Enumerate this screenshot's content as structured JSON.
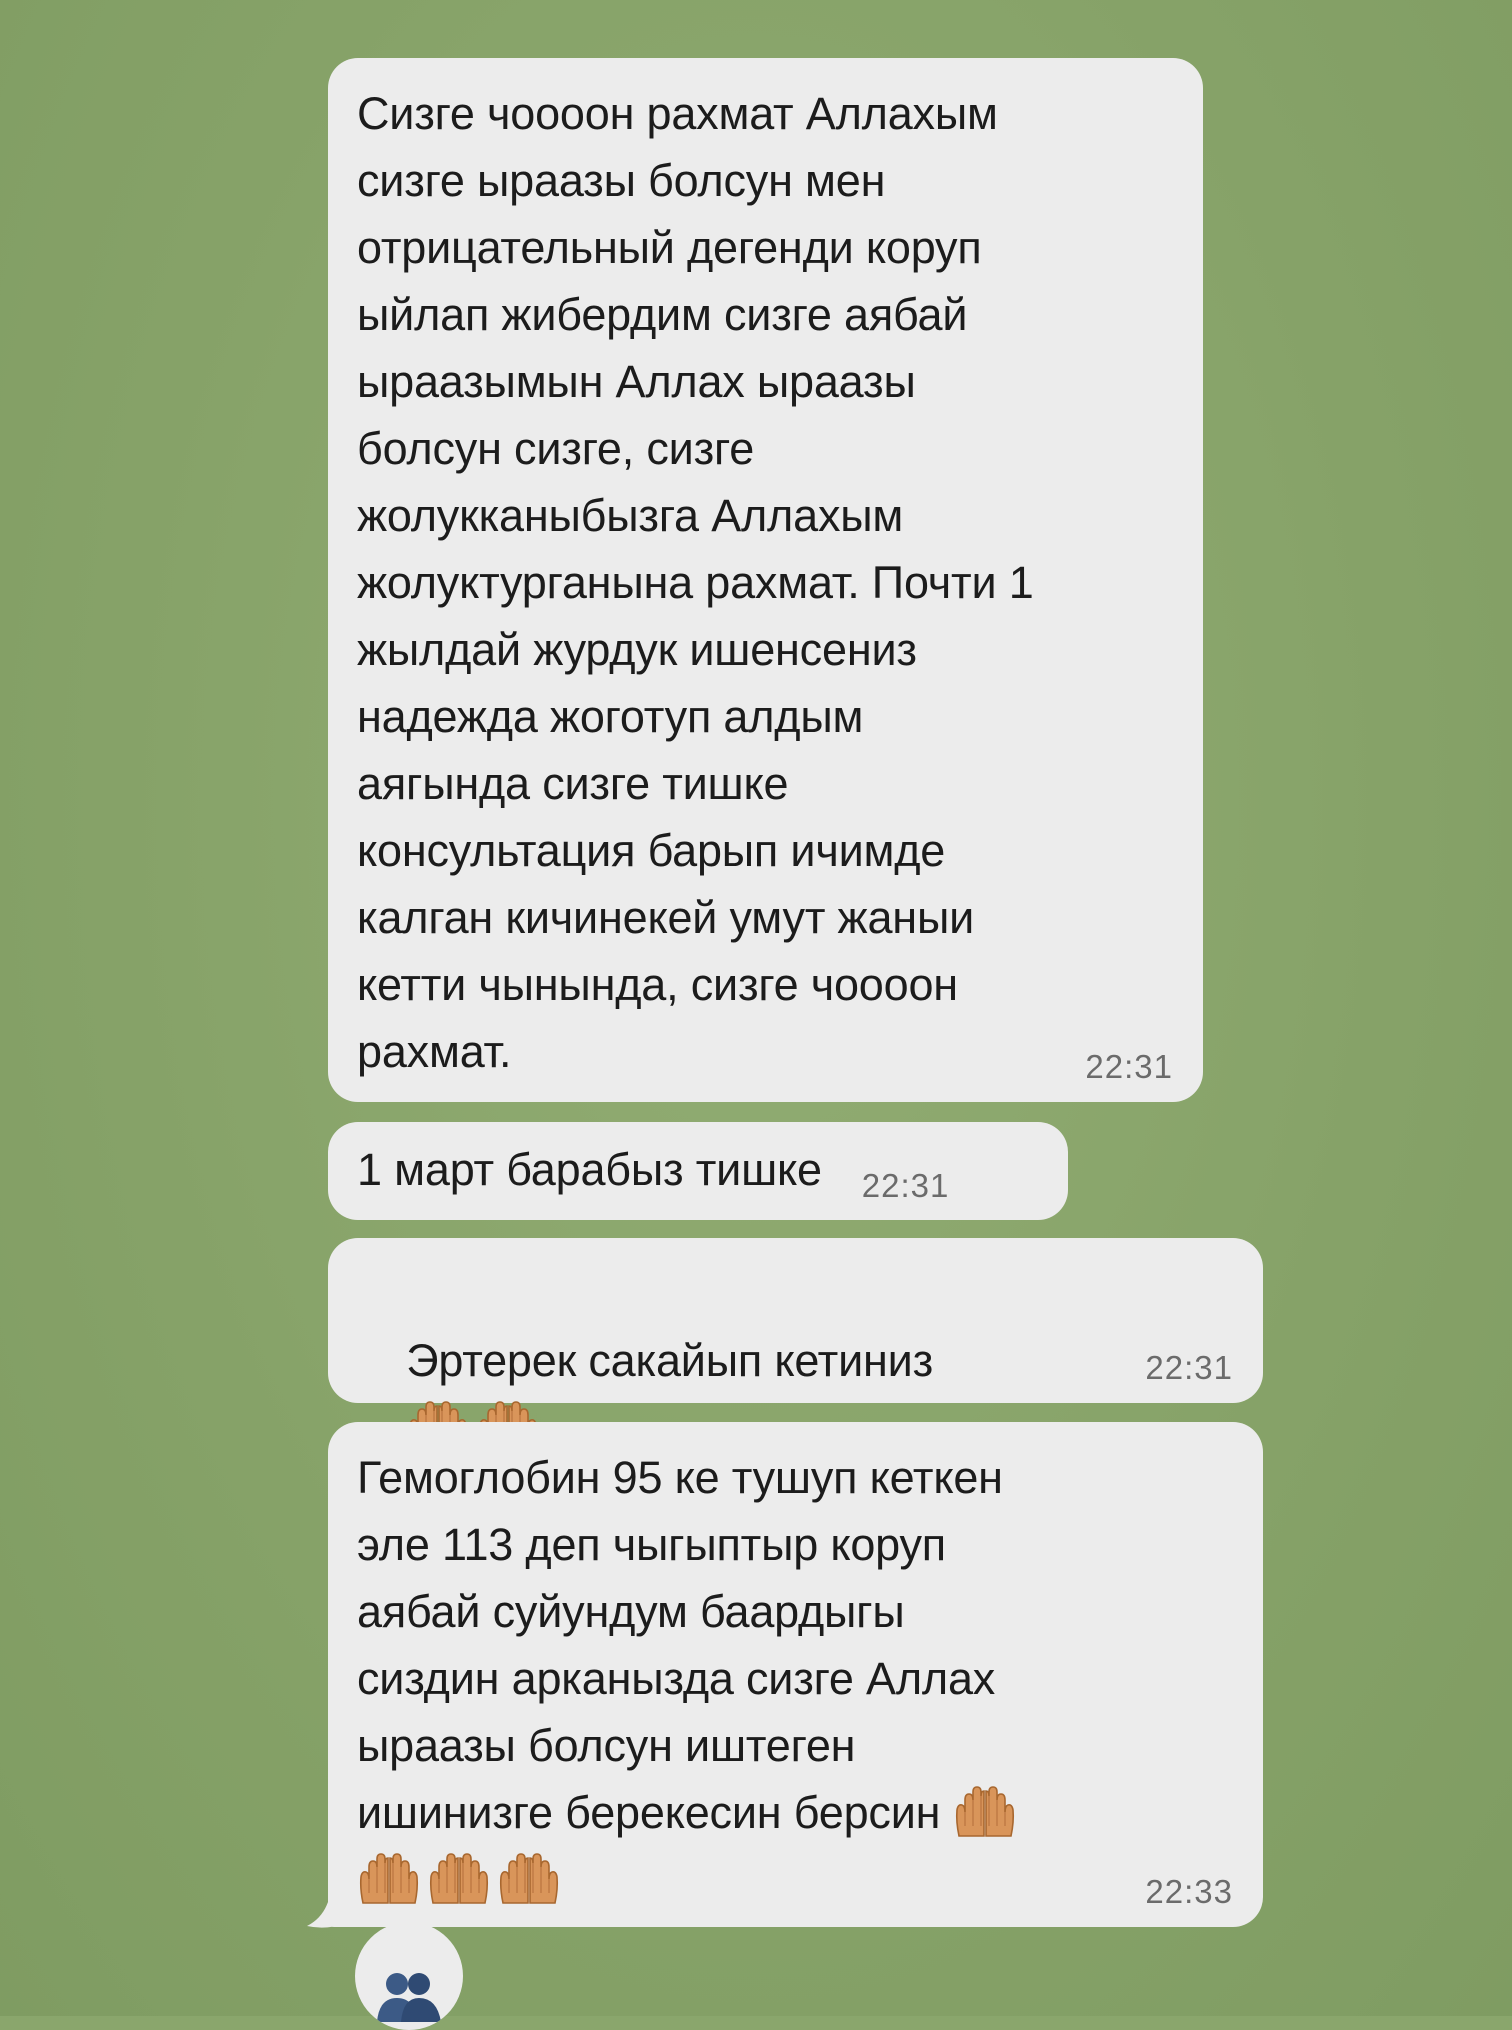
{
  "chat": {
    "messages": [
      {
        "text": "Сизге чоооон рахмат Аллахым\nсизге ыраазы болсун мен\nотрицательный дегенди коруп\nыйлап жибердим сизге аябай\nыраазымын Аллах ыраазы\nболсун сизге, сизге\nжолукканыбызга Аллахым\nжолуктурганына рахмат. Почти 1\nжылдай журдук ишенсениз\nнадежда жоготуп алдым\nаягында сизге тишке\nконсультация барып ичимде\nкалган кичинекей умут жаныи\nкетти чынында, сизге чоооон\nрахмат.",
        "time": "22:31"
      },
      {
        "text": "1 март барабыз тишке",
        "time": "22:31"
      },
      {
        "text": "Эртерек сакайып кетиниз",
        "time": "22:31",
        "emoji": "palms-up-together"
      },
      {
        "text": "Гемоглобин 95 ке тушуп кеткен\nэле 113 деп чыгыптыр коруп\nаябай суйундум баардыгы\nсиздин арканызда сизге Аллах\nыраазы болсун иштеген\nишинизге берекесин берсин",
        "time": "22:33",
        "emoji": "palms-up-together"
      }
    ]
  },
  "colors": {
    "background": "#8aa66c",
    "bubble": "#ececec",
    "text": "#1c1c1c",
    "time": "#6b6b6b",
    "emoji_skin": "#d9955a"
  },
  "icons": {
    "emoji": "palms-up-together-icon",
    "avatar": "user-avatar-icon"
  }
}
